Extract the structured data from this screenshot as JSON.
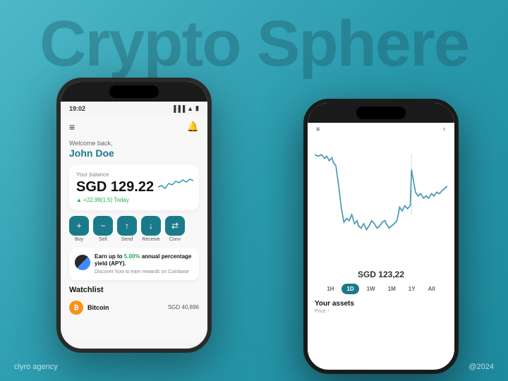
{
  "app": {
    "title": "Crypto Sphere",
    "footer_left": "clyro agency",
    "footer_right": "@2024"
  },
  "phone_left": {
    "status_time": "19:02",
    "welcome": "Welcome back,",
    "user_name": "John Doe",
    "balance": {
      "label": "Your balance",
      "amount": "SGD 129.22",
      "change": "+22.99(1.5) Today"
    },
    "actions": [
      {
        "label": "Buy",
        "icon": "+"
      },
      {
        "label": "Sell",
        "icon": "−"
      },
      {
        "label": "Send",
        "icon": "↑"
      },
      {
        "label": "Receive",
        "icon": "↓"
      },
      {
        "label": "Conv",
        "icon": "⇄"
      }
    ],
    "earn": {
      "title": "Earn up to 5.00% annual percentage yield (APY).",
      "highlight": "5.00%",
      "subtitle": "Discover how to earn rewards on Coinbase"
    },
    "watchlist_title": "Watchlist",
    "watchlist": [
      {
        "name": "Bitcoin",
        "price": "SGD 40,896"
      }
    ]
  },
  "phone_right": {
    "chart_price": "SGD 123,22",
    "time_periods": [
      "1H",
      "1D",
      "1W",
      "1M",
      "1Y",
      "All"
    ],
    "active_period": "1D",
    "your_assets": "Your assets",
    "price_label": "Price ↑"
  }
}
